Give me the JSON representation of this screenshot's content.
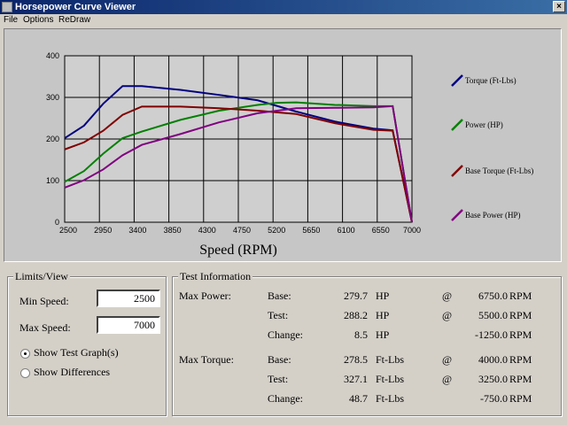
{
  "window": {
    "title": "Horsepower Curve Viewer",
    "close_glyph": "×"
  },
  "menu": [
    "File",
    "Options",
    "ReDraw"
  ],
  "chart_data": {
    "type": "line",
    "xlabel": "Speed (RPM)",
    "ylabel": "",
    "xlim": [
      2500,
      7000
    ],
    "ylim": [
      0,
      400
    ],
    "x_ticks": [
      2500,
      2950,
      3400,
      3850,
      4300,
      4750,
      5200,
      5650,
      6100,
      6550,
      7000
    ],
    "y_ticks": [
      0,
      100,
      200,
      300,
      400
    ],
    "grid": true,
    "legend": "right",
    "series": [
      {
        "name": "Torque (Ft-Lbs)",
        "color": "#000080",
        "x": [
          2500,
          2750,
          3000,
          3250,
          3500,
          4000,
          4500,
          5000,
          5500,
          6000,
          6500,
          6750,
          7000
        ],
        "y": [
          202,
          232,
          285,
          327,
          327,
          318,
          306,
          293,
          266,
          242,
          225,
          221,
          0
        ]
      },
      {
        "name": "Power (HP)",
        "color": "#008000",
        "x": [
          2500,
          2750,
          3000,
          3250,
          3500,
          4000,
          4500,
          5000,
          5250,
          5500,
          6000,
          6500,
          6750,
          7000
        ],
        "y": [
          97,
          123,
          165,
          202,
          218,
          246,
          268,
          282,
          287,
          288,
          282,
          279,
          279,
          0
        ]
      },
      {
        "name": "Base Torque (Ft-Lbs)",
        "color": "#800000",
        "x": [
          2500,
          2750,
          3000,
          3250,
          3500,
          4000,
          4500,
          5000,
          5500,
          6000,
          6500,
          6750,
          7000
        ],
        "y": [
          175,
          192,
          220,
          258,
          278,
          278,
          274,
          268,
          260,
          238,
          222,
          220,
          0
        ]
      },
      {
        "name": "Base Power (HP)",
        "color": "#800080",
        "x": [
          2500,
          2750,
          3000,
          3250,
          3500,
          4000,
          4500,
          5000,
          5500,
          6000,
          6500,
          6750,
          7000
        ],
        "y": [
          83,
          101,
          127,
          161,
          186,
          212,
          240,
          262,
          274,
          275,
          276,
          279,
          0
        ]
      }
    ]
  },
  "limits": {
    "title": "Limits/View",
    "min_label": "Min Speed:",
    "min_value": "2500",
    "max_label": "Max Speed:",
    "max_value": "7000",
    "show_test_label": "Show Test Graph(s)",
    "show_diff_label": "Show Differences",
    "selected": "show_test"
  },
  "test_info": {
    "title": "Test Information",
    "max_power_label": "Max Power:",
    "max_torque_label": "Max Torque:",
    "rows": [
      {
        "label": "Base:",
        "value": "279.7",
        "unit": "HP",
        "at": "@",
        "rpm": "6750.0",
        "rpm_unit": "RPM"
      },
      {
        "label": "Test:",
        "value": "288.2",
        "unit": "HP",
        "at": "@",
        "rpm": "5500.0",
        "rpm_unit": "RPM"
      },
      {
        "label": "Change:",
        "value": "8.5",
        "unit": "HP",
        "at": "",
        "rpm": "-1250.0",
        "rpm_unit": "RPM"
      },
      {
        "label": "Base:",
        "value": "278.5",
        "unit": "Ft-Lbs",
        "at": "@",
        "rpm": "4000.0",
        "rpm_unit": "RPM"
      },
      {
        "label": "Test:",
        "value": "327.1",
        "unit": "Ft-Lbs",
        "at": "@",
        "rpm": "3250.0",
        "rpm_unit": "RPM"
      },
      {
        "label": "Change:",
        "value": "48.7",
        "unit": "Ft-Lbs",
        "at": "",
        "rpm": "-750.0",
        "rpm_unit": "RPM"
      }
    ]
  }
}
